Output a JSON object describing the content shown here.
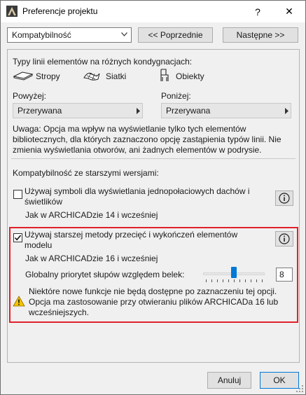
{
  "window": {
    "title": "Preferencje projektu",
    "help_label": "?",
    "close_label": "✕"
  },
  "header": {
    "combo_value": "Kompatybilność",
    "prev_label": "<< Poprzednie",
    "next_label": "Następne >>"
  },
  "line_types": {
    "heading": "Typy linii elementów na różnych kondygnacjach:",
    "stropy": "Stropy",
    "siatki": "Siatki",
    "obiekty": "Obiekty",
    "above_label": "Powyżej:",
    "above_value": "Przerywana",
    "below_label": "Poniżej:",
    "below_value": "Przerywana",
    "note": "Uwaga: Opcja ma wpływ na wyświetlanie tylko tych elementów bibliotecznych, dla których zaznaczono opcję zastąpienia typów linii. Nie zmienia wyświetlania otworów, ani żadnych elementów w podrysie."
  },
  "compat": {
    "heading": "Kompatybilność ze starszymi wersjami:",
    "option1_label": "Używaj symboli dla wyświetlania jednopołaciowych dachów i świetlików",
    "option1_checked": false,
    "option1_sub": "Jak w ARCHICADzie 14 i wcześniej",
    "option2_label": "Używaj starszej metody przecięć i wykończeń elementów modelu",
    "option2_checked": true,
    "option2_sub": "Jak w ARCHICADzie 16 i wcześniej",
    "priority_label": "Globalny priorytet słupów względem belek:",
    "priority_value": "8",
    "warning": "Niektóre nowe funkcje nie będą dostępne po zaznaczeniu tej opcji. Opcja ma zastosowanie przy otwieraniu plików ARCHICADa 16 lub wcześniejszych."
  },
  "footer": {
    "cancel_label": "Anuluj",
    "ok_label": "OK"
  },
  "colors": {
    "highlight": "#e1212b",
    "accent": "#0078d7",
    "warning": "#f5c400"
  },
  "icons": [
    "archicad-icon",
    "help-icon",
    "close-icon",
    "chevron-down-icon",
    "slab-icon",
    "mesh-icon",
    "object-icon",
    "info-icon",
    "warning-icon",
    "resize-grip-icon"
  ]
}
